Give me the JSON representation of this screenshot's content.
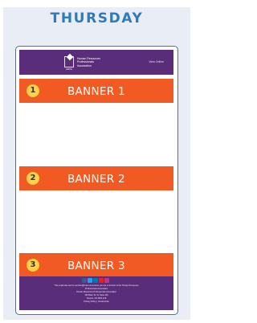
{
  "day_title": "THURSDAY",
  "colors": {
    "title_blue": "#2b7bbd",
    "panel_bg": "#e9eef6",
    "header_purple": "#5a2d7a",
    "banner_orange": "#f15a22",
    "number_badge_yellow": "#ffd24a"
  },
  "email": {
    "header": {
      "logo_abbr": "HRPA",
      "org_name_line1": "Human Resources",
      "org_name_line2": "Professionals",
      "org_name_line3": "Association",
      "view_online": "View Online"
    },
    "banners": [
      {
        "number": "1",
        "label": "BANNER 1"
      },
      {
        "number": "2",
        "label": "BANNER 2"
      },
      {
        "number": "3",
        "label": "BANNER 3"
      }
    ],
    "footer": {
      "social_icons": [
        "facebook-icon",
        "twitter-icon",
        "linkedin-icon",
        "youtube-icon",
        "instagram-icon"
      ],
      "line1": "This email was sent to member@hrpa.ca because you are a member of the Human Resources",
      "line2": "Professionals Association",
      "line3": "Human Resources Professionals Association",
      "line4": "150 Bloor St. W, Suite 200",
      "line5": "Toronto, ON M5S 2X9",
      "line6": "Privacy Policy | Unsubscribe"
    }
  }
}
